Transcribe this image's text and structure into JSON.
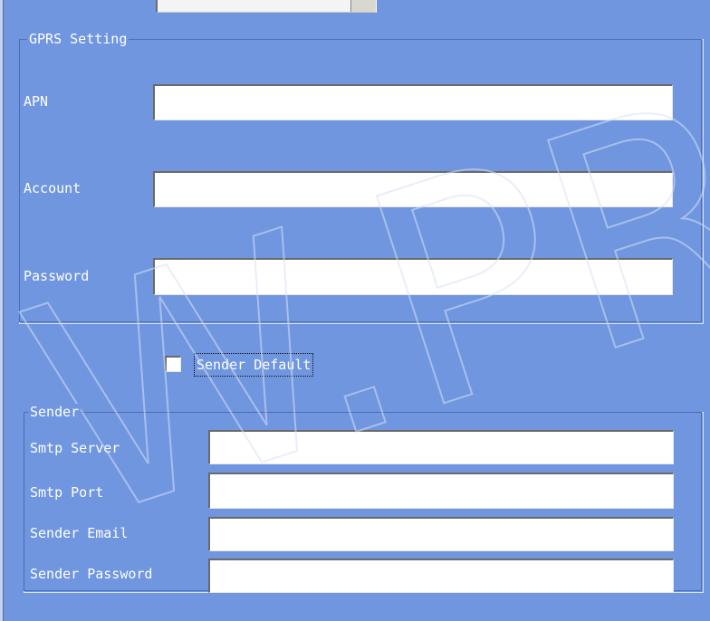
{
  "gprs": {
    "legend": "GPRS Setting",
    "apn": {
      "label": "APN",
      "value": ""
    },
    "account": {
      "label": "Account",
      "value": ""
    },
    "password": {
      "label": "Password",
      "value": ""
    }
  },
  "sender_default": {
    "label": "Sender Default",
    "checked": false
  },
  "sender": {
    "legend": "Sender",
    "smtp_server": {
      "label": "Smtp Server",
      "value": ""
    },
    "smtp_port": {
      "label": "Smtp Port",
      "value": ""
    },
    "sender_email": {
      "label": "Sender Email",
      "value": ""
    },
    "sender_password": {
      "label": "Sender Password",
      "value": ""
    }
  },
  "watermark_text": "W.PRC",
  "colors": {
    "background": "#7096e0",
    "field_bg": "#ffffff"
  }
}
